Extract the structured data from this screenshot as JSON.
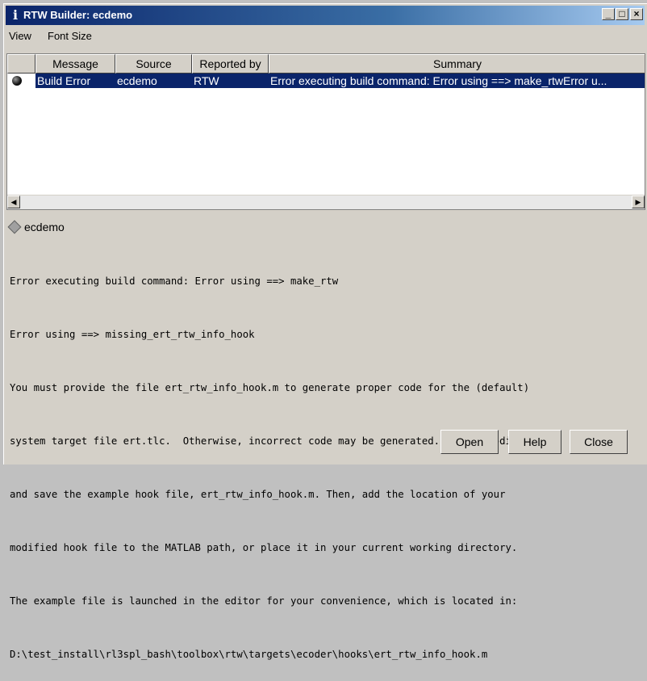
{
  "window": {
    "title": "RTW Builder: ecdemo",
    "icon": "info-icon"
  },
  "menu": [
    "View",
    "Font Size"
  ],
  "table": {
    "columns": [
      "Message",
      "Source",
      "Reported by",
      "Summary"
    ],
    "rows": [
      {
        "message": "Build Error",
        "source": "ecdemo",
        "reported_by": "RTW",
        "summary": "Error executing build command: Error using ==> make_rtwError u..."
      }
    ]
  },
  "detail": {
    "title": "ecdemo",
    "lines": [
      "Error executing build command: Error using ==> make_rtw",
      "Error using ==> missing_ert_rtw_info_hook",
      "You must provide the file ert_rtw_info_hook.m to generate proper code for the (default)",
      "system target file ert.tlc.  Otherwise, incorrect code may be generated.  Copy, modify",
      "and save the example hook file, ert_rtw_info_hook.m. Then, add the location of your",
      "modified hook file to the MATLAB path, or place it in your current working directory.",
      "The example file is launched in the editor for your convenience, which is located in:",
      "D:\\test_install\\rl3spl_bash\\toolbox\\rtw\\targets\\ecoder\\hooks\\ert_rtw_info_hook.m"
    ]
  },
  "buttons": {
    "open": "Open",
    "help": "Help",
    "close": "Close"
  },
  "colors": {
    "title_bar": "#0a246a",
    "selection": "#0a246a"
  }
}
